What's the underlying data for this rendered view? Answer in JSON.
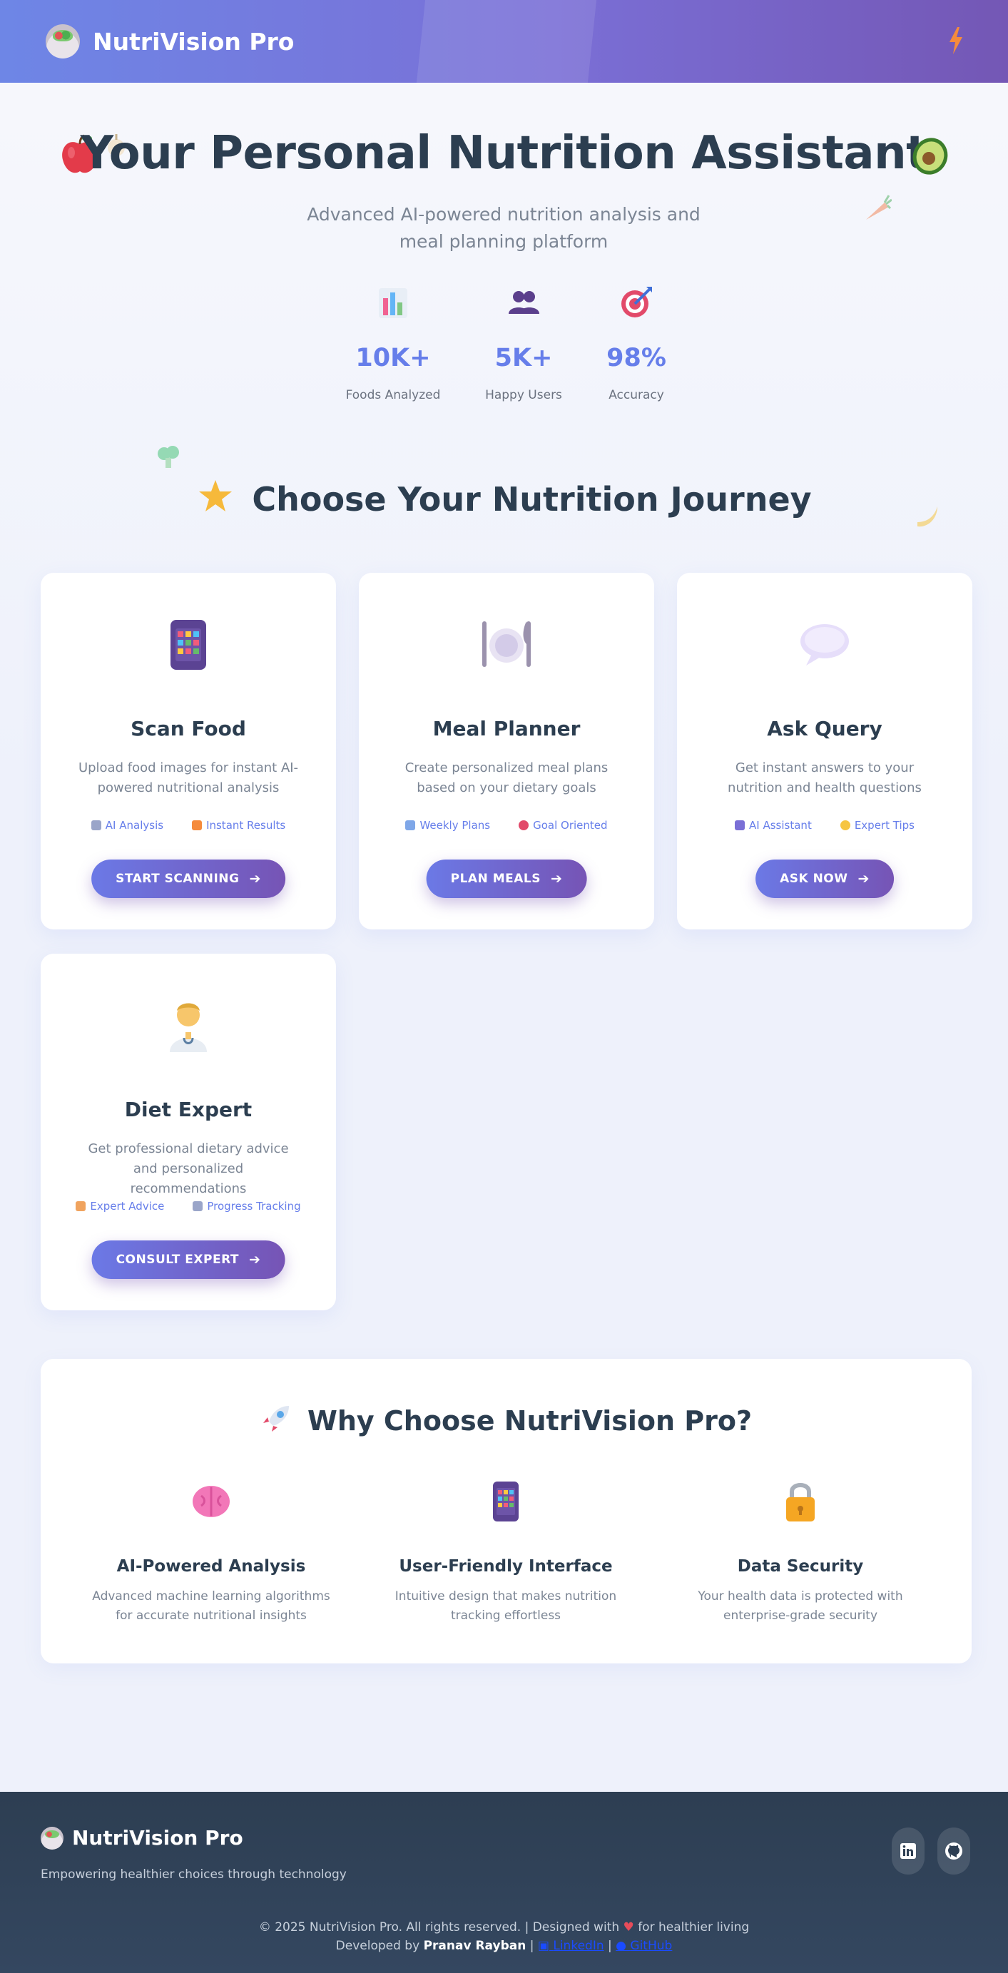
{
  "header": {
    "brand": "NutriVision Pro",
    "logo_icon": "salad-bowl-icon",
    "action_icon": "lightning-icon"
  },
  "hero": {
    "title": "Your Personal Nutrition Assistant",
    "subtitle": "Advanced AI-powered nutrition analysis and meal planning platform",
    "stats": [
      {
        "icon": "bar-chart-icon",
        "value": "10K+",
        "label": "Foods Analyzed"
      },
      {
        "icon": "users-icon",
        "value": "5K+",
        "label": "Happy Users"
      },
      {
        "icon": "target-icon",
        "value": "98%",
        "label": "Accuracy"
      }
    ]
  },
  "journey": {
    "title": "Choose Your Nutrition Journey",
    "cards": [
      {
        "icon": "mobile-phone-icon",
        "title": "Scan Food",
        "description": "Upload food images for instant AI-powered nutritional analysis",
        "tags": [
          "AI Analysis",
          "Instant Results"
        ],
        "button": "START SCANNING"
      },
      {
        "icon": "plate-cutlery-icon",
        "title": "Meal Planner",
        "description": "Create personalized meal plans based on your dietary goals",
        "tags": [
          "Weekly Plans",
          "Goal Oriented"
        ],
        "button": "PLAN MEALS"
      },
      {
        "icon": "speech-bubble-icon",
        "title": "Ask Query",
        "description": "Get instant answers to your nutrition and health questions",
        "tags": [
          "AI Assistant",
          "Expert Tips"
        ],
        "button": "ASK NOW"
      },
      {
        "icon": "doctor-icon",
        "title": "Diet Expert",
        "description": "Get professional dietary advice and personalized recommendations",
        "tags": [
          "Expert Advice",
          "Progress Tracking"
        ],
        "button": "CONSULT EXPERT"
      }
    ]
  },
  "why": {
    "title": "Why Choose NutriVision Pro?",
    "features": [
      {
        "icon": "brain-icon",
        "title": "AI-Powered Analysis",
        "description": "Advanced machine learning algorithms for accurate nutritional insights"
      },
      {
        "icon": "mobile-phone-icon",
        "title": "User-Friendly Interface",
        "description": "Intuitive design that makes nutrition tracking effortless"
      },
      {
        "icon": "lock-icon",
        "title": "Data Security",
        "description": "Your health data is protected with enterprise-grade security"
      }
    ]
  },
  "footer": {
    "brand": "NutriVision Pro",
    "tagline": "Empowering healthier choices through technology",
    "copyright_pre": "© 2025 NutriVision Pro. All rights reserved. | Designed with",
    "copyright_post": "for healthier living",
    "dev_pre": "Developed by",
    "developer": "Pranav Rayban",
    "sep": "|",
    "linkedin": "LinkedIn",
    "github": "GitHub"
  },
  "colors": {
    "accent": "#667eea",
    "accent_dark": "#764ba2",
    "heading": "#2c3e50",
    "footer_bg": "#2d3e52"
  }
}
